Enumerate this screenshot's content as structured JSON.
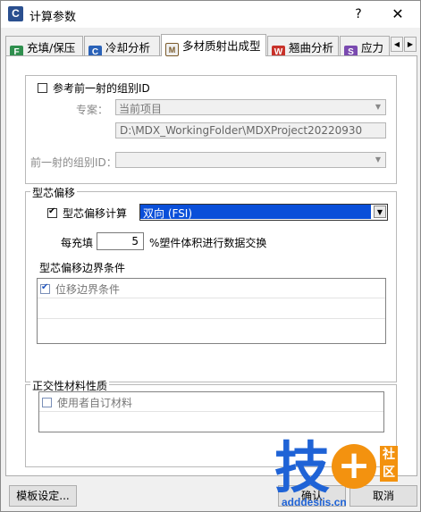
{
  "window": {
    "title": "计算参数",
    "icon": "C",
    "help": "?",
    "close": "✕"
  },
  "tabs": [
    {
      "label": "充填/保压",
      "icon": "F",
      "icon_color": "#2f8f4e"
    },
    {
      "label": "冷却分析",
      "icon": "C",
      "icon_color": "#2a62b8"
    },
    {
      "label": "多材质射出成型",
      "icon": "M",
      "icon_color": "#7a5a2a",
      "active": true
    },
    {
      "label": "翘曲分析",
      "icon": "W",
      "icon_color": "#c8322a"
    },
    {
      "label": "应力",
      "icon": "S",
      "icon_color": "#7a4ab0"
    }
  ],
  "tab_scroll": {
    "left": "◀",
    "right": "▶"
  },
  "prev_shot": {
    "checkbox_label": "参考前一射的组别ID",
    "checked": false,
    "project_label": "专案：",
    "project_value": "当前项目",
    "path_value": "D:\\MDX_WorkingFolder\\MDXProject20220930",
    "group_id_label": "前一射的组别ID：",
    "group_id_value": ""
  },
  "core_shift": {
    "group_title": "型芯偏移",
    "calc_label": "型芯偏移计算",
    "calc_checked": true,
    "calc_value": "双向 (FSI)",
    "per_fill_label": "每充填",
    "per_fill_value": "5",
    "per_fill_suffix": "%塑件体积进行数据交换",
    "boundary_title": "型芯偏移边界条件",
    "boundary_items": [
      {
        "label": "位移边界条件",
        "checked": true
      }
    ]
  },
  "orthotropic": {
    "group_title": "正交性材料性质",
    "items": [
      {
        "label": "使用者自订材料",
        "checked": false
      }
    ]
  },
  "buttons": {
    "template": "模板设定...",
    "ok": "确认",
    "cancel": "取消"
  },
  "watermark": {
    "char": "技",
    "plus": "+",
    "badge": "社区",
    "url": "adddesiis.cn"
  }
}
